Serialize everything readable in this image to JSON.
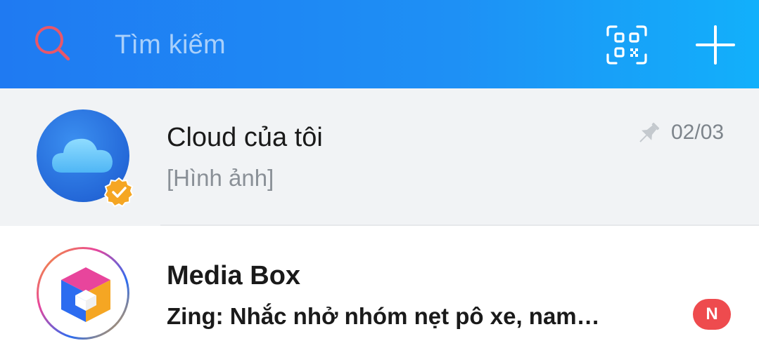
{
  "header": {
    "search_placeholder": "Tìm kiếm",
    "icons": [
      "search-icon",
      "qr-code-icon",
      "plus-icon"
    ]
  },
  "conversations": [
    {
      "title": "Cloud của tôi",
      "preview": "[Hình ảnh]",
      "date": "02/03",
      "pinned": true,
      "verified": true,
      "icon": "cloud-icon"
    },
    {
      "title": "Media Box",
      "preview": "Zing: Nhắc nhở nhóm nẹt pô xe, nam…",
      "badge": "N",
      "icon": "media-box-logo"
    }
  ],
  "colors": {
    "header_gradient_start": "#1f7af2",
    "header_gradient_end": "#12b0fb",
    "search_icon": "#e8576a",
    "pinned_row_bg": "#f1f3f5",
    "badge_red": "#ee4b4e",
    "verified_orange": "#f5a623"
  }
}
